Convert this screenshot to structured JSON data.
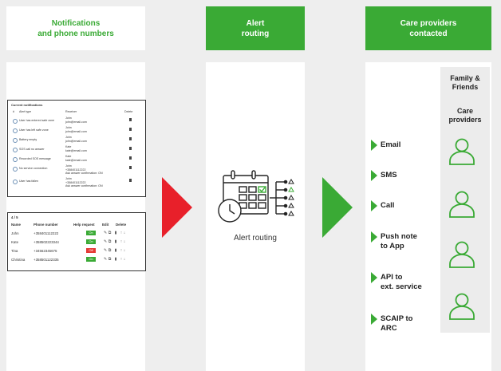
{
  "columns": {
    "notifications": {
      "title_line1": "Notifications",
      "title_line2": "and phone numbers"
    },
    "routing": {
      "title_line1": "Alert",
      "title_line2": "routing",
      "caption": "Alert routing"
    },
    "providers": {
      "title_line1": "Care providers",
      "title_line2": "contacted"
    }
  },
  "notifications_panel": {
    "title": "Current notifications",
    "headers": {
      "type": "Alert type",
      "receiver": "Receiver",
      "delete": "Delete"
    },
    "rows": [
      {
        "type": "User has entered safe zone",
        "receiver": "John\njohn@email.com"
      },
      {
        "type": "User has left safe zone",
        "receiver": "John\njohn@email.com"
      },
      {
        "type": "Battery empty",
        "receiver": "John\njohn@email.com"
      },
      {
        "type": "SOS call no answer",
        "receiver": "Kate\nkate@email.com"
      },
      {
        "type": "Recorded SOS message",
        "receiver": "Kate\nkate@email.com"
      },
      {
        "type": "No service connection",
        "receiver": "John\n+358401112222\nAsk answer confirmation: ON"
      },
      {
        "type": "User has fallen",
        "receiver": "John\n+358401112222\nAsk answer confirmation: ON"
      }
    ]
  },
  "phone_panel": {
    "count": "4 / 5",
    "headers": {
      "name": "Name",
      "phone": "Phone number",
      "help": "Help request",
      "edit": "Edit",
      "delete": "Delete"
    },
    "rows": [
      {
        "name": "John",
        "phone": "+358401112222",
        "help": "On",
        "help_color": "#3aaa35"
      },
      {
        "name": "Kate",
        "phone": "+358502223344",
        "help": "On",
        "help_color": "#3aaa35"
      },
      {
        "name": "Tina",
        "phone": "+34562345675",
        "help": "Off",
        "help_color": "#e53935"
      },
      {
        "name": "Christina",
        "phone": "+358501122335",
        "help": "On",
        "help_color": "#3aaa35"
      }
    ]
  },
  "channels": [
    {
      "label_line1": "Email",
      "label_line2": ""
    },
    {
      "label_line1": "SMS",
      "label_line2": ""
    },
    {
      "label_line1": "Call",
      "label_line2": ""
    },
    {
      "label_line1": "Push note",
      "label_line2": "to App"
    },
    {
      "label_line1": "API to",
      "label_line2": "ext. service"
    },
    {
      "label_line1": "SCAIP to",
      "label_line2": "ARC"
    }
  ],
  "recipient_groups": {
    "family_line1": "Family &",
    "family_line2": "Friends",
    "care_line1": "Care",
    "care_line2": "providers"
  },
  "colors": {
    "accent_green": "#3aaa35",
    "arrow_red": "#e8202a",
    "background": "#eeeeee"
  }
}
